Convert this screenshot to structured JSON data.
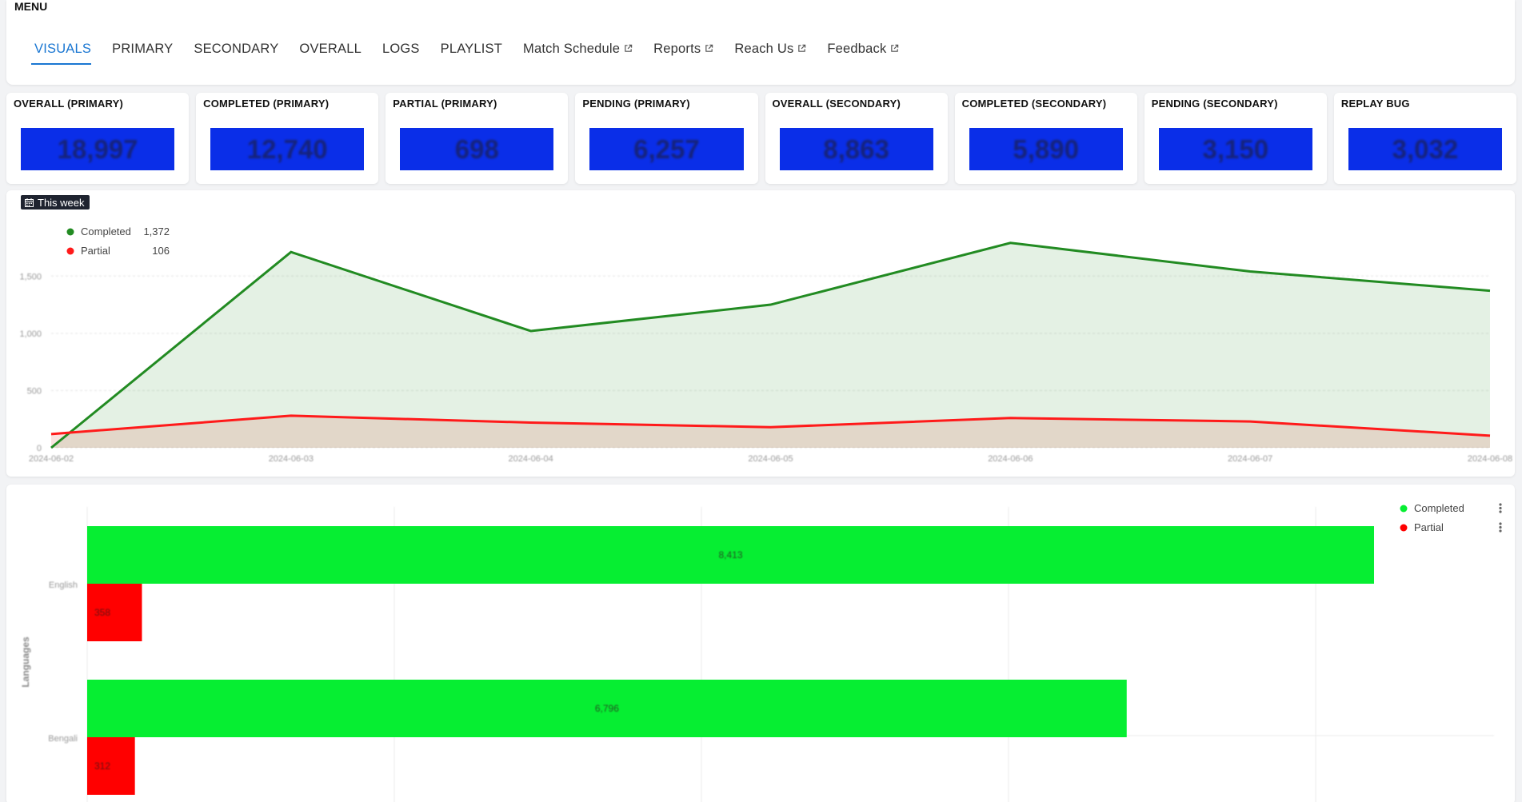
{
  "menu": {
    "title": "MENU",
    "items": [
      {
        "label": "VISUALS",
        "active": true,
        "external": false
      },
      {
        "label": "PRIMARY",
        "active": false,
        "external": false
      },
      {
        "label": "SECONDARY",
        "active": false,
        "external": false
      },
      {
        "label": "OVERALL",
        "active": false,
        "external": false
      },
      {
        "label": "LOGS",
        "active": false,
        "external": false
      },
      {
        "label": "PLAYLIST",
        "active": false,
        "external": false
      },
      {
        "label": "Match Schedule",
        "active": false,
        "external": true
      },
      {
        "label": "Reports",
        "active": false,
        "external": true
      },
      {
        "label": "Reach Us",
        "active": false,
        "external": true
      },
      {
        "label": "Feedback",
        "active": false,
        "external": true
      }
    ]
  },
  "stats": [
    {
      "label": "OVERALL (PRIMARY)",
      "value": "18,997"
    },
    {
      "label": "COMPLETED (PRIMARY)",
      "value": "12,740"
    },
    {
      "label": "PARTIAL (PRIMARY)",
      "value": "698"
    },
    {
      "label": "PENDING (PRIMARY)",
      "value": "6,257"
    },
    {
      "label": "OVERALL (SECONDARY)",
      "value": "8,863"
    },
    {
      "label": "COMPLETED (SECONDARY)",
      "value": "5,890"
    },
    {
      "label": "PENDING (SECONDARY)",
      "value": "3,150"
    },
    {
      "label": "REPLAY BUG",
      "value": "3,032"
    }
  ],
  "colors": {
    "accent": "#1976d2",
    "stat_box": "#0a2ee8",
    "completed_line": "#228b22",
    "partial_line": "#ff1a1a",
    "completed_bar": "#06ee32",
    "partial_bar": "#ff0000"
  },
  "filter": {
    "label": "This week",
    "icon": "calendar-icon"
  },
  "chart_data": [
    {
      "type": "area",
      "title": "",
      "x": [
        "2024-06-02",
        "2024-06-03",
        "2024-06-04",
        "2024-06-05",
        "2024-06-06",
        "2024-06-07",
        "2024-06-08"
      ],
      "series": [
        {
          "name": "Completed",
          "values": [
            0,
            1710,
            1020,
            1250,
            1790,
            1540,
            1372
          ]
        },
        {
          "name": "Partial",
          "values": [
            120,
            280,
            220,
            180,
            260,
            230,
            106
          ]
        }
      ],
      "legend": [
        {
          "name": "Completed",
          "value": "1,372"
        },
        {
          "name": "Partial",
          "value": "106"
        }
      ],
      "yticks": [
        "0",
        "500",
        "1,000",
        "1,500"
      ],
      "ylim": [
        0,
        1900
      ],
      "legend_position": "top-left",
      "grid": true
    },
    {
      "type": "bar",
      "orientation": "horizontal",
      "categories": [
        "English",
        "Bengali"
      ],
      "series": [
        {
          "name": "Completed",
          "values": [
            8413,
            6796
          ],
          "labels": [
            "8,413"
          ]
        },
        {
          "name": "Partial",
          "values": [
            358,
            312
          ],
          "labels": [
            "358"
          ]
        }
      ],
      "value_labels": {
        "completed": [
          "8,413",
          "6,796"
        ],
        "partial": [
          "358",
          "312"
        ]
      },
      "ylabel": "Languages",
      "xlim": [
        0,
        10000
      ],
      "legend_position": "top-right",
      "grid": true
    }
  ]
}
